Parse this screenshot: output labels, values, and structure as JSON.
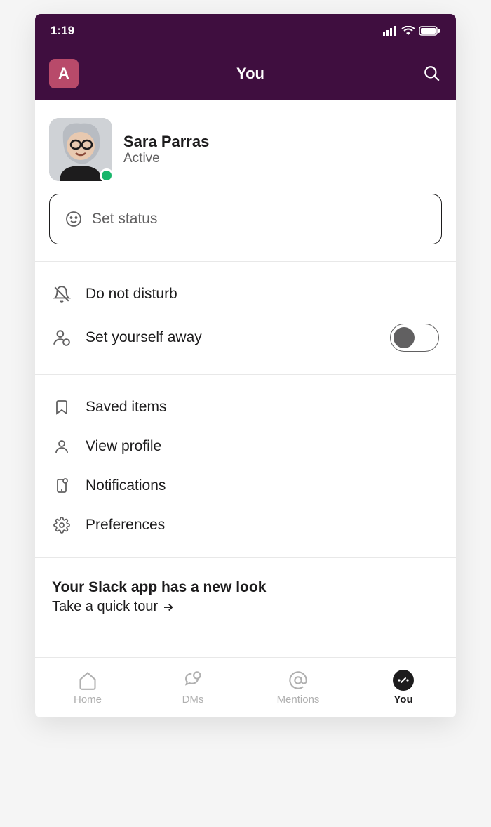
{
  "status_bar": {
    "time": "1:19"
  },
  "header": {
    "workspace_letter": "A",
    "title": "You"
  },
  "profile": {
    "name": "Sara Parras",
    "presence": "Active"
  },
  "status_input": {
    "placeholder": "Set status"
  },
  "menu1": {
    "dnd": "Do not disturb",
    "away": "Set yourself away"
  },
  "menu2": {
    "saved": "Saved items",
    "profile": "View profile",
    "notifications": "Notifications",
    "preferences": "Preferences"
  },
  "new_look": {
    "title": "Your Slack app has a new look",
    "link": "Take a quick tour"
  },
  "tabs": {
    "home": "Home",
    "dms": "DMs",
    "mentions": "Mentions",
    "you": "You"
  }
}
